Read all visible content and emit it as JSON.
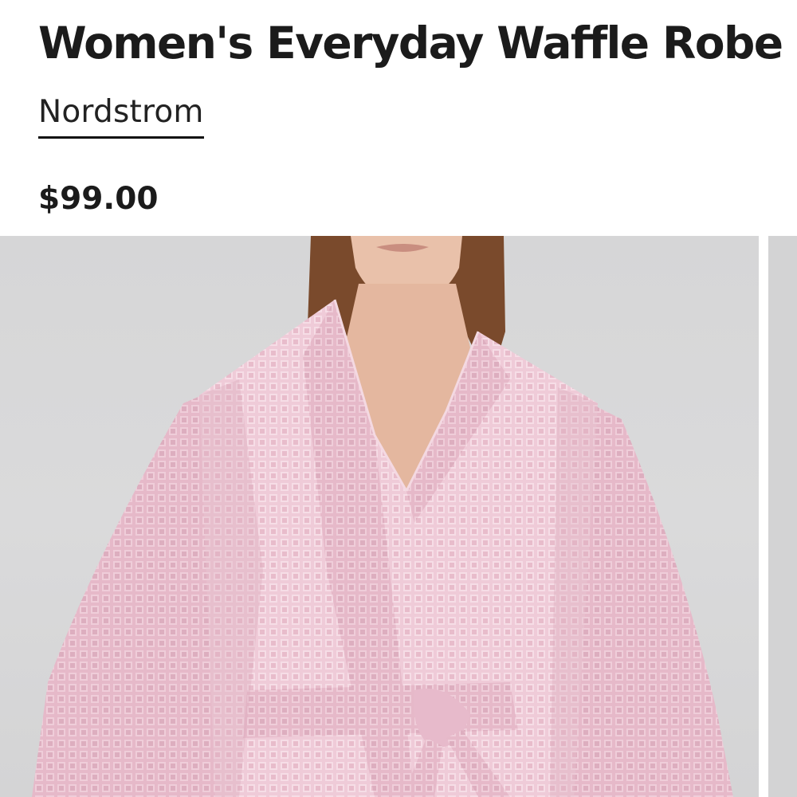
{
  "product": {
    "title": "Women's Everyday Waffle Robe",
    "brand": "Nordstrom",
    "price": "$99.00"
  },
  "gallery": {
    "image_subject": "model-wearing-pink-waffle-robe",
    "colors": {
      "backdrop": "#d8d8d9",
      "robe": "#eec9d6",
      "skin": "#e4b79f",
      "hair": "#7a4a2c"
    }
  }
}
